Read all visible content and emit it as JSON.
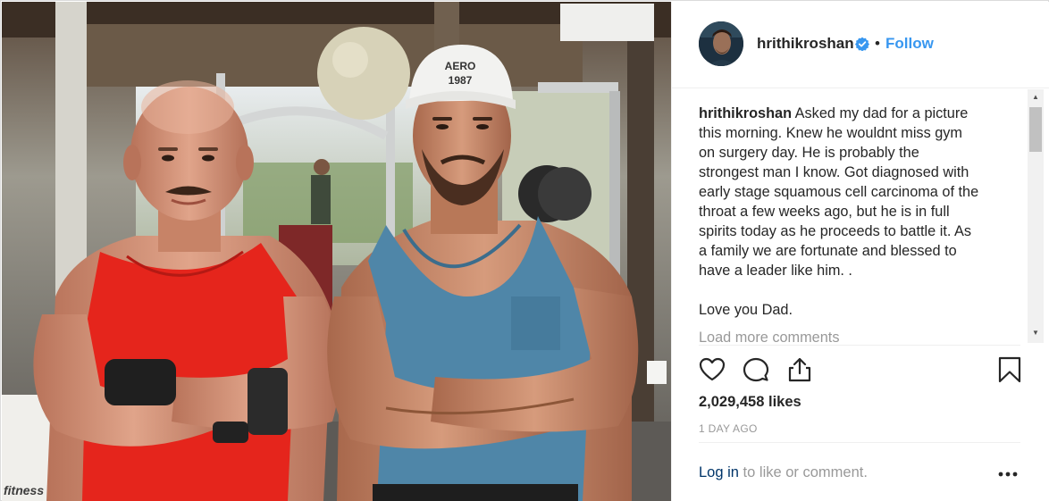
{
  "post": {
    "author": {
      "username": "hrithikroshan",
      "verified": true,
      "separator": "•",
      "follow_label": "Follow"
    },
    "caption": {
      "author": "hrithikroshan",
      "lines": [
        "Asked my dad for a picture",
        "this morning. Knew he wouldnt miss gym",
        "on surgery day. He is probably the",
        "strongest man I know. Got diagnosed with",
        "early stage squamous cell carcinoma of the",
        "throat a few weeks ago, but he is in full",
        "spirits today as he proceeds to battle it. As",
        "a family we are fortunate and blessed to",
        "have a leader like him. ."
      ],
      "closing": "Love you Dad."
    },
    "load_more_label": "Load more comments",
    "likes_text": "2,029,458 likes",
    "timestamp": "1 DAY AGO",
    "footer": {
      "login_link": "Log in",
      "login_suffix": " to like or comment."
    },
    "photo": {
      "cap_text_line1": "AERO",
      "cap_text_line2": "1987",
      "bench_brand": "fitness"
    }
  },
  "icons": {
    "verified": "verified-badge-icon",
    "like": "heart-icon",
    "comment": "comment-bubble-icon",
    "share": "share-icon",
    "save": "bookmark-icon",
    "more": "more-options-icon"
  },
  "colors": {
    "link_blue": "#3897f0",
    "dark_link": "#003569",
    "muted": "#999999",
    "text": "#262626",
    "red_vest": "#e5251c",
    "blue_vest": "#4f86a8"
  }
}
